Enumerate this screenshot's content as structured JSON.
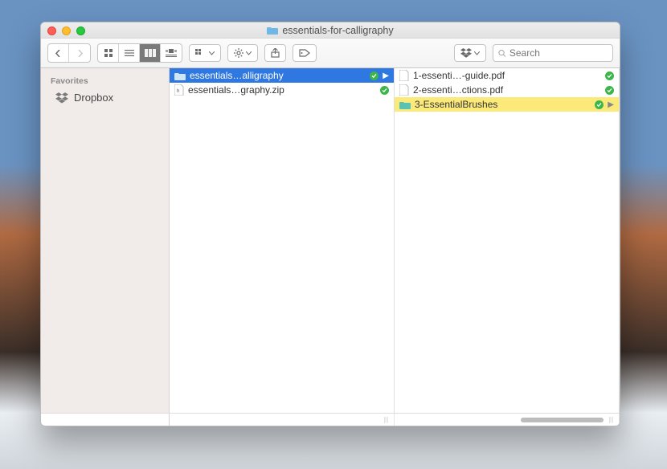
{
  "window": {
    "title": "essentials-for-calligraphy"
  },
  "toolbar": {
    "search_placeholder": "Search"
  },
  "sidebar": {
    "header": "Favorites",
    "items": [
      {
        "label": "Dropbox"
      }
    ]
  },
  "columns": [
    {
      "items": [
        {
          "label": "essentials…alligraphy",
          "icon": "folder",
          "synced": true,
          "has_children": true,
          "selected": "blue"
        },
        {
          "label": "essentials…graphy.zip",
          "icon": "file",
          "synced": true,
          "has_children": false
        }
      ]
    },
    {
      "items": [
        {
          "label": "1-essenti…-guide.pdf",
          "icon": "file",
          "synced": true,
          "has_children": false
        },
        {
          "label": "2-essenti…ctions.pdf",
          "icon": "file",
          "synced": true,
          "has_children": false
        },
        {
          "label": "3-EssentialBrushes",
          "icon": "folder",
          "synced": true,
          "has_children": true,
          "selected": "yellow"
        }
      ]
    }
  ]
}
